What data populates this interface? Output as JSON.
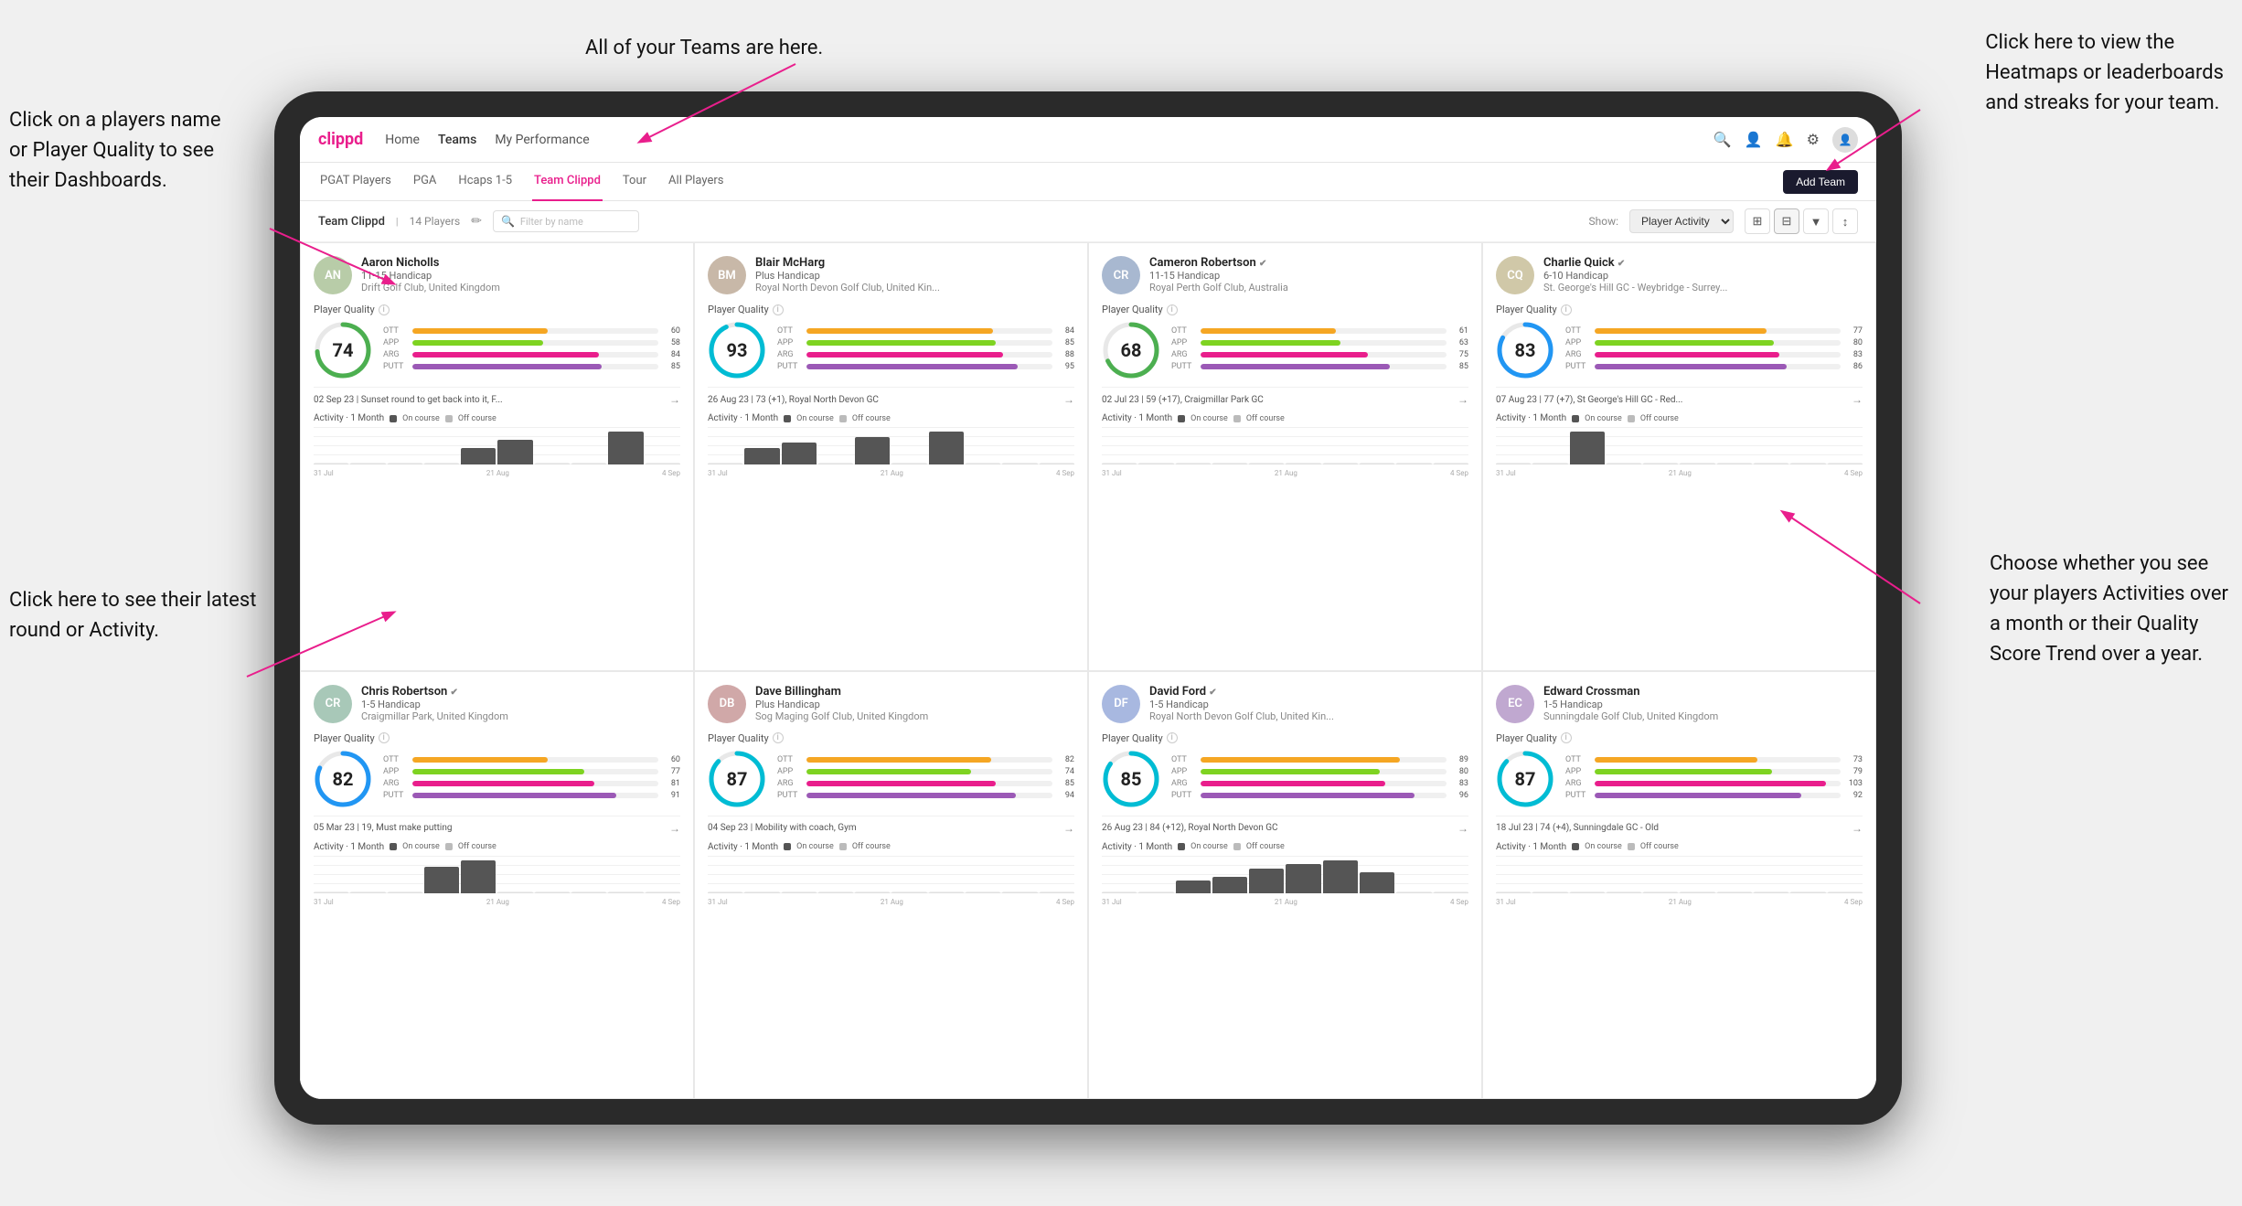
{
  "annotations": {
    "top_center": "All of your Teams are here.",
    "top_right_title": "Click here to view the\nHeatmaps or leaderboards\nand streaks for your team.",
    "left_top": "Click on a players name\nor Player Quality to see\ntheir Dashboards.",
    "left_bottom": "Click here to see their latest\nround or Activity.",
    "right_bottom": "Choose whether you see\nyour players Activities over\na month or their Quality\nScore Trend over a year."
  },
  "nav": {
    "logo": "clippd",
    "links": [
      "Home",
      "Teams",
      "My Performance"
    ],
    "active": "Teams"
  },
  "sub_nav": {
    "links": [
      "PGAT Players",
      "PGA",
      "Hcaps 1-5",
      "Team Clippd",
      "Tour",
      "All Players"
    ],
    "active": "Team Clippd",
    "add_button": "Add Team"
  },
  "team_bar": {
    "team_name": "Team Clippd",
    "player_count": "14 Players",
    "search_placeholder": "Filter by name",
    "show_label": "Show:",
    "show_option": "Player Activity",
    "view_options": [
      "grid-2",
      "grid-3",
      "filter",
      "sort"
    ]
  },
  "players": [
    {
      "name": "Aaron Nicholls",
      "handicap": "11-15 Handicap",
      "club": "Drift Golf Club, United Kingdom",
      "quality": 74,
      "stats": [
        {
          "name": "OTT",
          "value": 60,
          "color": "#f5a623"
        },
        {
          "name": "APP",
          "value": 58,
          "color": "#7ed321"
        },
        {
          "name": "ARG",
          "value": 84,
          "color": "#e91e8c"
        },
        {
          "name": "PUTT",
          "value": 85,
          "color": "#9b59b6"
        }
      ],
      "latest_round": "02 Sep 23 | Sunset round to get back into it, F...",
      "chart_bars": [
        0,
        0,
        0,
        0,
        2,
        3,
        0,
        0,
        4,
        0
      ],
      "chart_labels": [
        "31 Jul",
        "21 Aug",
        "4 Sep"
      ],
      "verified": false,
      "avatar_color": "#b8cca8",
      "avatar_text": "AN"
    },
    {
      "name": "Blair McHarg",
      "handicap": "Plus Handicap",
      "club": "Royal North Devon Golf Club, United Kin...",
      "quality": 93,
      "stats": [
        {
          "name": "OTT",
          "value": 84,
          "color": "#f5a623"
        },
        {
          "name": "APP",
          "value": 85,
          "color": "#7ed321"
        },
        {
          "name": "ARG",
          "value": 88,
          "color": "#e91e8c"
        },
        {
          "name": "PUTT",
          "value": 95,
          "color": "#9b59b6"
        }
      ],
      "latest_round": "26 Aug 23 | 73 (+1), Royal North Devon GC",
      "chart_bars": [
        0,
        3,
        4,
        0,
        5,
        0,
        6,
        0,
        0,
        0
      ],
      "chart_labels": [
        "31 Jul",
        "21 Aug",
        "4 Sep"
      ],
      "verified": false,
      "avatar_color": "#c8b8a8",
      "avatar_text": "BM"
    },
    {
      "name": "Cameron Robertson",
      "handicap": "11-15 Handicap",
      "club": "Royal Perth Golf Club, Australia",
      "quality": 68,
      "stats": [
        {
          "name": "OTT",
          "value": 61,
          "color": "#f5a623"
        },
        {
          "name": "APP",
          "value": 63,
          "color": "#7ed321"
        },
        {
          "name": "ARG",
          "value": 75,
          "color": "#e91e8c"
        },
        {
          "name": "PUTT",
          "value": 85,
          "color": "#9b59b6"
        }
      ],
      "latest_round": "02 Jul 23 | 59 (+17), Craigmillar Park GC",
      "chart_bars": [
        0,
        0,
        0,
        0,
        0,
        0,
        0,
        0,
        0,
        0
      ],
      "chart_labels": [
        "31 Jul",
        "21 Aug",
        "4 Sep"
      ],
      "verified": true,
      "avatar_color": "#a8b8d0",
      "avatar_text": "CR"
    },
    {
      "name": "Charlie Quick",
      "handicap": "6-10 Handicap",
      "club": "St. George's Hill GC - Weybridge - Surrey...",
      "quality": 83,
      "stats": [
        {
          "name": "OTT",
          "value": 77,
          "color": "#f5a623"
        },
        {
          "name": "APP",
          "value": 80,
          "color": "#7ed321"
        },
        {
          "name": "ARG",
          "value": 83,
          "color": "#e91e8c"
        },
        {
          "name": "PUTT",
          "value": 86,
          "color": "#9b59b6"
        }
      ],
      "latest_round": "07 Aug 23 | 77 (+7), St George's Hill GC - Red...",
      "chart_bars": [
        0,
        0,
        3,
        0,
        0,
        0,
        0,
        0,
        0,
        0
      ],
      "chart_labels": [
        "31 Jul",
        "21 Aug",
        "4 Sep"
      ],
      "verified": true,
      "avatar_color": "#d0c8a8",
      "avatar_text": "CQ"
    },
    {
      "name": "Chris Robertson",
      "handicap": "1-5 Handicap",
      "club": "Craigmillar Park, United Kingdom",
      "quality": 82,
      "stats": [
        {
          "name": "OTT",
          "value": 60,
          "color": "#f5a623"
        },
        {
          "name": "APP",
          "value": 77,
          "color": "#7ed321"
        },
        {
          "name": "ARG",
          "value": 81,
          "color": "#e91e8c"
        },
        {
          "name": "PUTT",
          "value": 91,
          "color": "#9b59b6"
        }
      ],
      "latest_round": "05 Mar 23 | 19, Must make putting",
      "chart_bars": [
        0,
        0,
        0,
        4,
        5,
        0,
        0,
        0,
        0,
        0
      ],
      "chart_labels": [
        "31 Jul",
        "21 Aug",
        "4 Sep"
      ],
      "verified": true,
      "avatar_color": "#a8c8b8",
      "avatar_text": "CR"
    },
    {
      "name": "Dave Billingham",
      "handicap": "Plus Handicap",
      "club": "Sog Maging Golf Club, United Kingdom",
      "quality": 87,
      "stats": [
        {
          "name": "OTT",
          "value": 82,
          "color": "#f5a623"
        },
        {
          "name": "APP",
          "value": 74,
          "color": "#7ed321"
        },
        {
          "name": "ARG",
          "value": 85,
          "color": "#e91e8c"
        },
        {
          "name": "PUTT",
          "value": 94,
          "color": "#9b59b6"
        }
      ],
      "latest_round": "04 Sep 23 | Mobility with coach, Gym",
      "chart_bars": [
        0,
        0,
        0,
        0,
        0,
        0,
        0,
        0,
        0,
        0
      ],
      "chart_labels": [
        "31 Jul",
        "21 Aug",
        "4 Sep"
      ],
      "verified": false,
      "avatar_color": "#d0a8a8",
      "avatar_text": "DB"
    },
    {
      "name": "David Ford",
      "handicap": "1-5 Handicap",
      "club": "Royal North Devon Golf Club, United Kin...",
      "quality": 85,
      "stats": [
        {
          "name": "OTT",
          "value": 89,
          "color": "#f5a623"
        },
        {
          "name": "APP",
          "value": 80,
          "color": "#7ed321"
        },
        {
          "name": "ARG",
          "value": 83,
          "color": "#e91e8c"
        },
        {
          "name": "PUTT",
          "value": 96,
          "color": "#9b59b6"
        }
      ],
      "latest_round": "26 Aug 23 | 84 (+12), Royal North Devon GC",
      "chart_bars": [
        0,
        0,
        3,
        4,
        6,
        7,
        8,
        5,
        0,
        0
      ],
      "chart_labels": [
        "31 Jul",
        "21 Aug",
        "4 Sep"
      ],
      "verified": true,
      "avatar_color": "#a8b8e0",
      "avatar_text": "DF"
    },
    {
      "name": "Edward Crossman",
      "handicap": "1-5 Handicap",
      "club": "Sunningdale Golf Club, United Kingdom",
      "quality": 87,
      "stats": [
        {
          "name": "OTT",
          "value": 73,
          "color": "#f5a623"
        },
        {
          "name": "APP",
          "value": 79,
          "color": "#7ed321"
        },
        {
          "name": "ARG",
          "value": 103,
          "color": "#e91e8c"
        },
        {
          "name": "PUTT",
          "value": 92,
          "color": "#9b59b6"
        }
      ],
      "latest_round": "18 Jul 23 | 74 (+4), Sunningdale GC - Old",
      "chart_bars": [
        0,
        0,
        0,
        0,
        0,
        0,
        0,
        0,
        0,
        0
      ],
      "chart_labels": [
        "31 Jul",
        "21 Aug",
        "4 Sep"
      ],
      "verified": false,
      "avatar_color": "#c0a8d0",
      "avatar_text": "EC"
    }
  ]
}
